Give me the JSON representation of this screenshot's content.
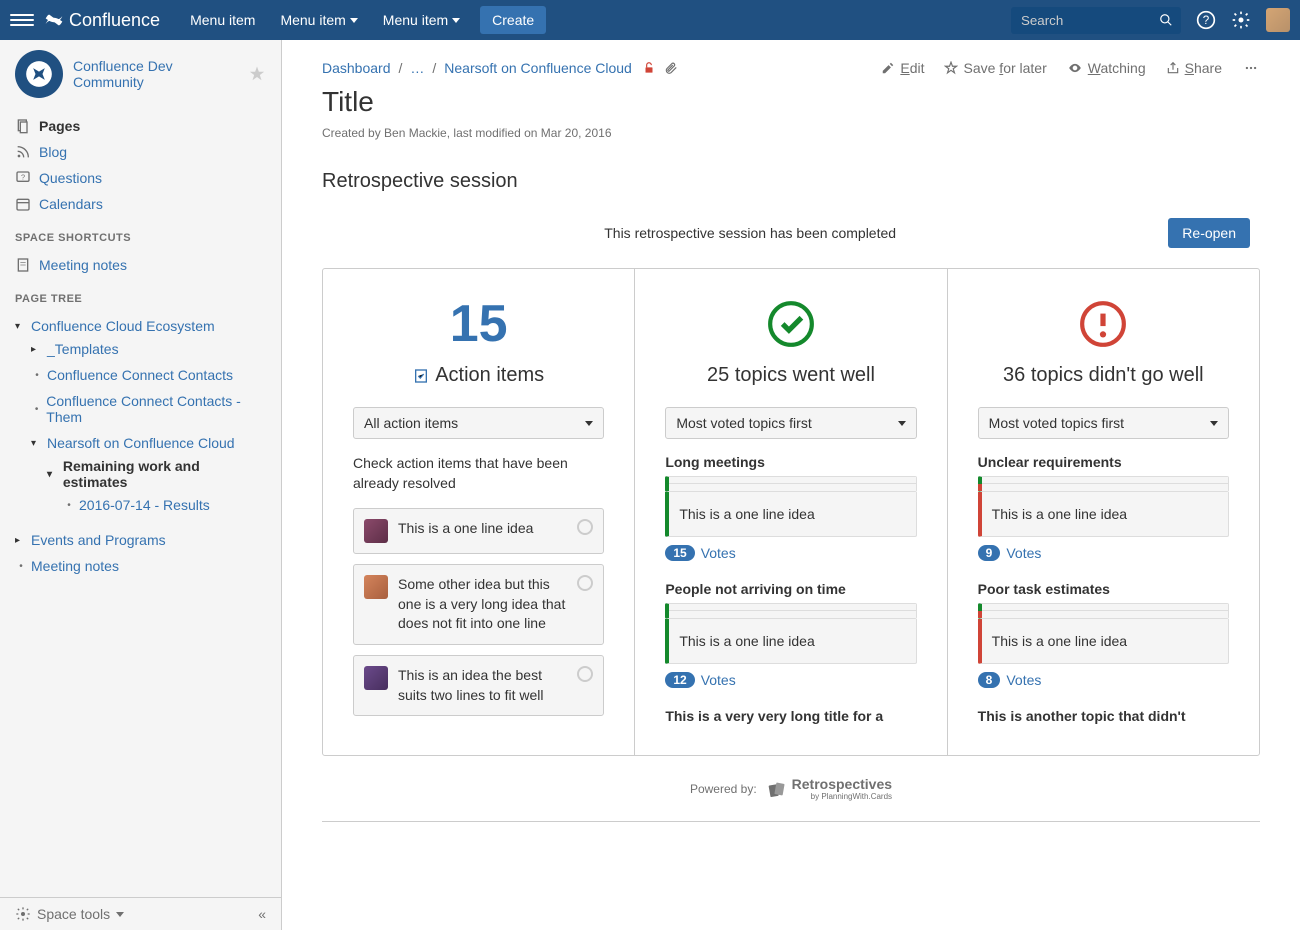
{
  "header": {
    "logo_text": "Confluence",
    "menu_items": [
      "Menu item",
      "Menu item",
      "Menu item"
    ],
    "create_label": "Create",
    "search_placeholder": "Search"
  },
  "sidebar": {
    "space_name": "Confluence Dev Community",
    "nav": {
      "pages": "Pages",
      "blog": "Blog",
      "questions": "Questions",
      "calendars": "Calendars"
    },
    "shortcuts_label": "SPACE SHORTCUTS",
    "shortcuts": {
      "meeting_notes": "Meeting notes"
    },
    "tree_label": "PAGE TREE",
    "tree": {
      "root": "Confluence Cloud Ecosystem",
      "templates": "_Templates",
      "contacts": "Confluence Connect Contacts",
      "contacts_them": "Confluence Connect Contacts - Them",
      "nearsoft": "Nearsoft on Confluence Cloud",
      "remaining": "Remaining work and estimates",
      "results": "2016-07-14 - Results",
      "events": "Events and Programs",
      "meeting_notes2": "Meeting notes"
    },
    "footer": {
      "space_tools": "Space tools"
    }
  },
  "breadcrumb": {
    "dashboard": "Dashboard",
    "ellipsis": "…",
    "nearsoft": "Nearsoft on Confluence Cloud"
  },
  "page_actions": {
    "edit": "Edit",
    "save": "Save for later",
    "watching": "Watching",
    "share": "Share"
  },
  "page": {
    "title": "Title",
    "meta": "Created by Ben Mackie, last modified on Mar 20, 2016",
    "section_title": "Retrospective session",
    "status_text": "This retrospective session has been completed",
    "reopen_label": "Re-open"
  },
  "columns": {
    "action": {
      "count": "15",
      "heading": "Action items",
      "dropdown": "All action items",
      "desc": "Check action items that have been already resolved",
      "items": [
        "This is a one line idea",
        "Some other idea but this one is a very long idea that does not fit into one line",
        "This is an idea the best suits two lines to fit well"
      ]
    },
    "good": {
      "heading": "25 topics went well",
      "dropdown": "Most voted topics first",
      "topics": [
        {
          "title": "Long meetings",
          "idea": "This is a one line idea",
          "votes": "15",
          "votes_label": "Votes"
        },
        {
          "title": "People not arriving on time",
          "idea": "This is a one line idea",
          "votes": "12",
          "votes_label": "Votes"
        }
      ],
      "overflow": "This is a very very long title for a"
    },
    "bad": {
      "heading": "36 topics didn't go well",
      "dropdown": "Most voted topics first",
      "topics": [
        {
          "title": "Unclear requirements",
          "idea": "This is a one line idea",
          "votes": "9",
          "votes_label": "Votes"
        },
        {
          "title": "Poor task estimates",
          "idea": "This is a one line idea",
          "votes": "8",
          "votes_label": "Votes"
        }
      ],
      "overflow": "This is another topic that didn't"
    }
  },
  "footer": {
    "powered": "Powered by:",
    "brand": "Retrospectives",
    "sub": "by PlanningWith.Cards"
  }
}
